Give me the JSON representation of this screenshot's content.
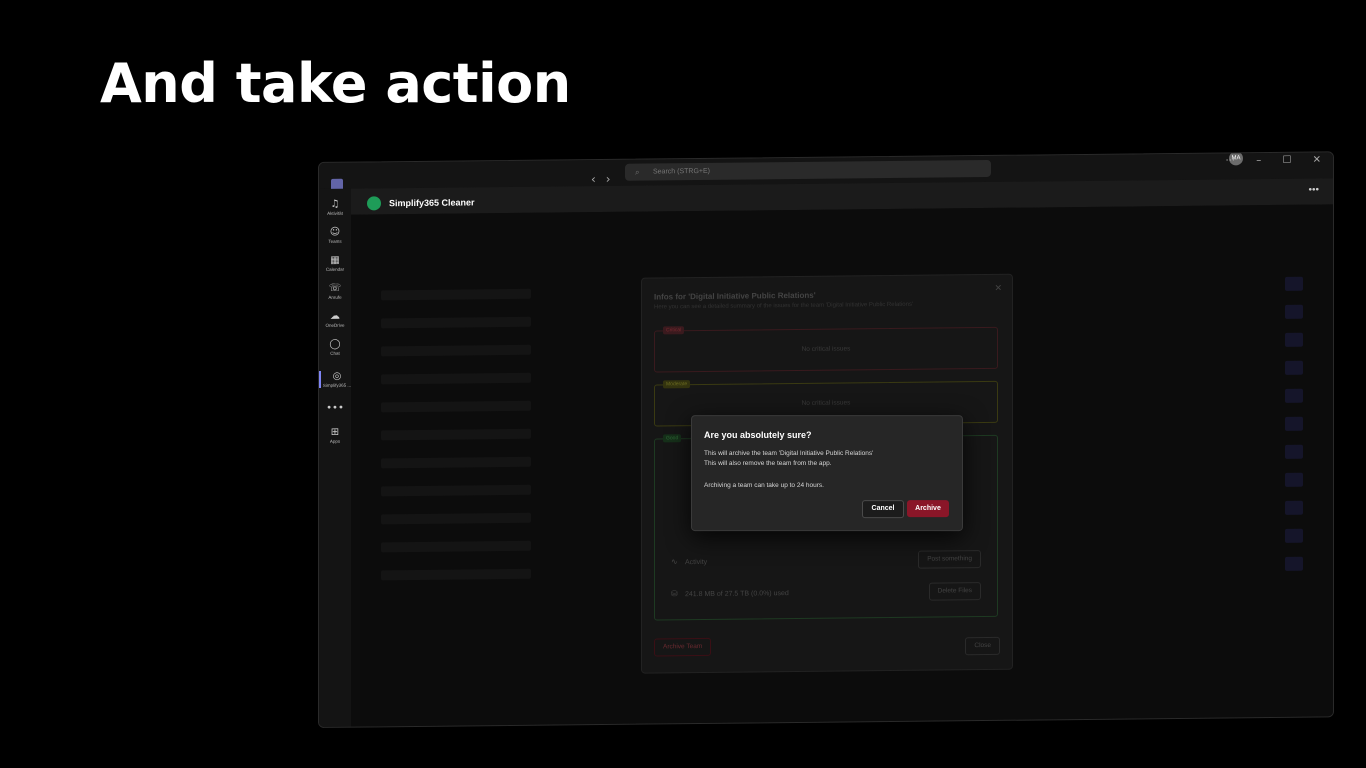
{
  "headline": "And take action",
  "titlebar": {
    "search_placeholder": "Search (STRG+E)",
    "avatar_initials": "MA"
  },
  "rail": {
    "items": [
      {
        "label": "Aktivität",
        "icon": "bell-icon"
      },
      {
        "label": "Teams",
        "icon": "teams-icon"
      },
      {
        "label": "Calendar",
        "icon": "calendar-icon"
      },
      {
        "label": "Anrufe",
        "icon": "phone-icon"
      },
      {
        "label": "OneDrive",
        "icon": "cloud-icon"
      },
      {
        "label": "Chat",
        "icon": "chat-icon"
      },
      {
        "label": "Simplify365 ...",
        "icon": "simplify-icon"
      },
      {
        "label": "Apps",
        "icon": "plus-icon"
      }
    ],
    "more": "•••"
  },
  "app": {
    "title": "Simplify365 Cleaner",
    "more": "•••"
  },
  "info_panel": {
    "title": "Infos for 'Digital Initiative Public Relations'",
    "subtitle": "Here you can see a detailed summary of the issues for the team 'Digital Initiative Public Relations'",
    "critical_tag": "Critical",
    "critical_msg": "No critical issues",
    "moderate_tag": "Moderate",
    "moderate_msg": "No critical issues",
    "good_tag": "Good",
    "rows": [
      {
        "label": "Activity",
        "button": "Post something",
        "icon": "activity-icon"
      },
      {
        "label": "241.8 MB of 27.5 TB (0.0%) used",
        "button": "Delete Files",
        "icon": "storage-icon"
      }
    ],
    "archive_team": "Archive Team",
    "close": "Close"
  },
  "dialog": {
    "title": "Are you absolutely sure?",
    "line1": "This will archive the team 'Digital Initiative Public Relations'",
    "line2": "This will also remove the team from the app.",
    "line3": "Archiving a team can take up to 24 hours.",
    "cancel": "Cancel",
    "archive": "Archive"
  },
  "colors": {
    "accent": "#7f85f5",
    "danger": "#8a1628",
    "brand": "#1e9c58"
  }
}
